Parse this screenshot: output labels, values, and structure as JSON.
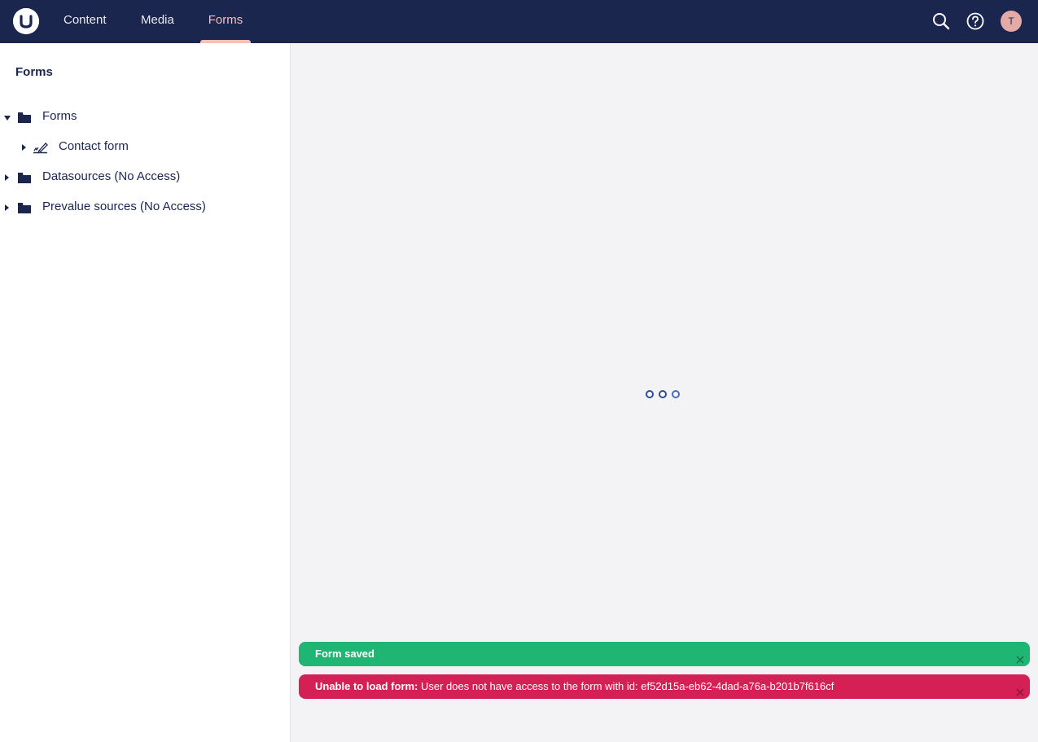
{
  "header": {
    "nav": [
      {
        "label": "Content"
      },
      {
        "label": "Media"
      },
      {
        "label": "Forms"
      }
    ],
    "avatar_initial": "T",
    "colors": {
      "background": "#1b264f",
      "active": "#f5c1bc"
    }
  },
  "sidebar": {
    "title": "Forms",
    "tree": [
      {
        "label": "Forms",
        "icon": "folder-icon",
        "expanded": true
      },
      {
        "label": "Contact form",
        "icon": "form-icon",
        "expanded": false
      },
      {
        "label": "Datasources (No Access)",
        "icon": "folder-icon",
        "expanded": false
      },
      {
        "label": "Prevalue sources (No Access)",
        "icon": "folder-icon",
        "expanded": false
      }
    ]
  },
  "main": {
    "loading": true
  },
  "notifications": [
    {
      "type": "success",
      "text": "Form saved",
      "color": "#1fb572"
    },
    {
      "type": "error",
      "title": "Unable to load form:",
      "text": " User does not have access to the form with id: ef52d15a-eb62-4dad-a76a-b201b7f616cf",
      "color": "#d42054"
    }
  ]
}
